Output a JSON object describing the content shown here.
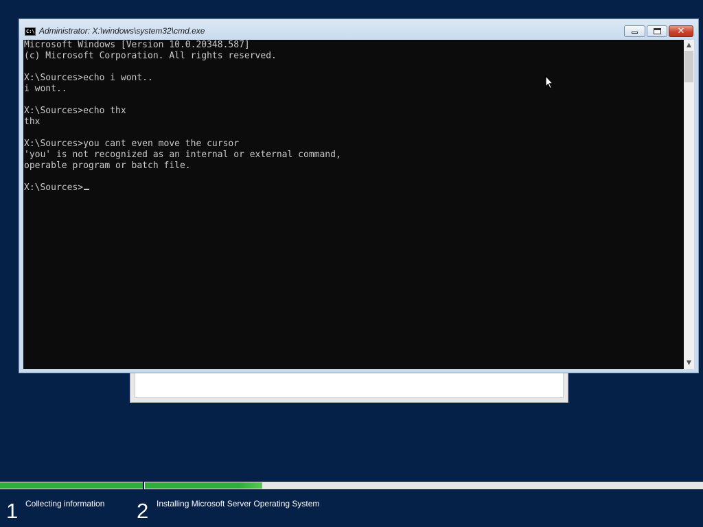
{
  "window": {
    "title": "Administrator: X:\\windows\\system32\\cmd.exe",
    "icon": "cmd-icon",
    "icon_label": "C:\\.",
    "buttons": {
      "minimize": "minimize-icon",
      "maximize": "maximize-icon",
      "close": "✕"
    }
  },
  "console": {
    "lines": [
      "Microsoft Windows [Version 10.0.20348.587]",
      "(c) Microsoft Corporation. All rights reserved.",
      "",
      "X:\\Sources>echo i wont..",
      "i wont..",
      "",
      "X:\\Sources>echo thx",
      "thx",
      "",
      "X:\\Sources>you cant even move the cursor",
      "'you' is not recognized as an internal or external command,",
      "operable program or batch file.",
      "",
      "X:\\Sources>"
    ]
  },
  "scrollbar": {
    "up_arrow": "▲",
    "down_arrow": "▼"
  },
  "setup_progress": {
    "steps": [
      {
        "number": "1",
        "label": "Collecting information",
        "progress": 1.0
      },
      {
        "number": "2",
        "label": "Installing Microsoft Server Operating System",
        "progress": 0.21
      }
    ]
  },
  "colors": {
    "desktop_background": "#062147",
    "console_background": "#0c0c0c",
    "console_text": "#cccccc",
    "progress_fill": "#2eae3a"
  }
}
